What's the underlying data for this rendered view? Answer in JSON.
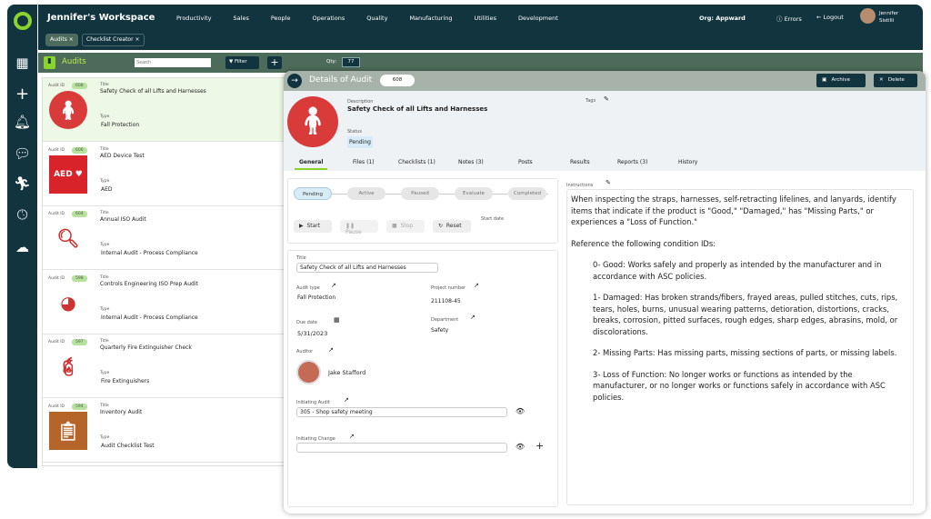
{
  "app": {
    "title": "Jennifer's Workspace",
    "nav": [
      "Productivity",
      "Sales",
      "People",
      "Operations",
      "Quality",
      "Manufacturing",
      "Utilities",
      "Development"
    ],
    "org_label": "Org:",
    "org": "Appward",
    "errors": "Errors",
    "logout": "Logout",
    "user_first": "Jennifer",
    "user_last": "Sistilli",
    "tabs": [
      "Audits",
      "Checklist Creator"
    ]
  },
  "audits": {
    "title": "Audits",
    "search_placeholder": "Search",
    "filter": "Filter",
    "qty_label": "Qty:",
    "qty": "77",
    "id_label": "Audit ID",
    "title_label": "Title",
    "type_label": "Type",
    "items": [
      {
        "id": "608",
        "title": "Safety Check of all Lifts and Harnesses",
        "type": "Fall Protection",
        "icon": "harness"
      },
      {
        "id": "606",
        "title": "AED Device Test",
        "type": "AED",
        "icon": "aed"
      },
      {
        "id": "604",
        "title": "Annual ISO Audit",
        "type": "Internal Audit - Process Compliance",
        "icon": "internal-audit"
      },
      {
        "id": "598",
        "title": "Controls Engineering ISO Prep Audit",
        "type": "Internal Audit - Process Compliance",
        "icon": "pdca"
      },
      {
        "id": "597",
        "title": "Quarterly Fire Extinguisher Check",
        "type": "Fire Extinguishers",
        "icon": "extinguisher"
      },
      {
        "id": "594",
        "title": "Inventory Audit",
        "type": "Audit Checklist Test",
        "icon": "clipboard"
      }
    ]
  },
  "detail": {
    "title": "Details of Audit",
    "id": "608",
    "archive": "Archive",
    "delete": "Delete",
    "description_label": "Description",
    "description": "Safety Check of all Lifts and Harnesses",
    "tags_label": "Tags",
    "status_label": "Status",
    "status": "Pending",
    "tabs": [
      "General",
      "Files (1)",
      "Checklists (1)",
      "Notes (3)",
      "Posts",
      "Results",
      "Reports (3)",
      "History"
    ],
    "steps": [
      "Pending",
      "Active",
      "Paused",
      "Evaluate",
      "Completed"
    ],
    "controls": [
      "Start",
      "Pause",
      "Stop",
      "Reset"
    ],
    "start_date_label": "Start date",
    "title_label": "Title",
    "title_value": "Safety Check of all Lifts and Harnesses",
    "audit_type_label": "Audit type",
    "audit_type": "Fall Protection",
    "project_number_label": "Project number",
    "project_number": "211108-45",
    "due_date_label": "Due date",
    "due_date": "5/31/2023",
    "department_label": "Department",
    "department": "Safety",
    "auditor_label": "Auditor",
    "auditor": "Jake Stafford",
    "initiating_audit_label": "Initiating Audit",
    "initiating_audit": "305 - Shop safety meeting",
    "initiating_change_label": "Initiating Change",
    "initiating_change": "",
    "instructions_label": "Instructions",
    "instructions": [
      "When inspecting the straps, harnesses, self-retracting lifelines, and lanyards, identify items that indicate if the product is \"Good,\" \"Damaged,\" has \"Missing Parts,\" or experiences a \"Loss of Function.\"",
      "Reference the following condition IDs:",
      "0- Good: Works safely and properly as intended by the manufacturer and in accordance with ASC policies.",
      "1- Damaged: Has broken strands/fibers, frayed areas, pulled stitches, cuts, rips, tears, holes, burns, unusual wearing patterns, detioration, distortions, cracks, breaks, corrosion, pitted surfaces, rough edges, sharp edges, abrasins, mold, or discolorations.",
      "2- Missing Parts: Has missing parts, missing sections of parts, or missing labels.",
      "3- Loss of Function: No longer works or functions as intended by the manufacturer, or no longer works or functions safely in accordance with ASC policies."
    ]
  },
  "colors": {
    "navy": "#12343f",
    "accent": "#8ad22c",
    "greenbar": "#4d6b5a",
    "selected": "#eef8e6"
  }
}
